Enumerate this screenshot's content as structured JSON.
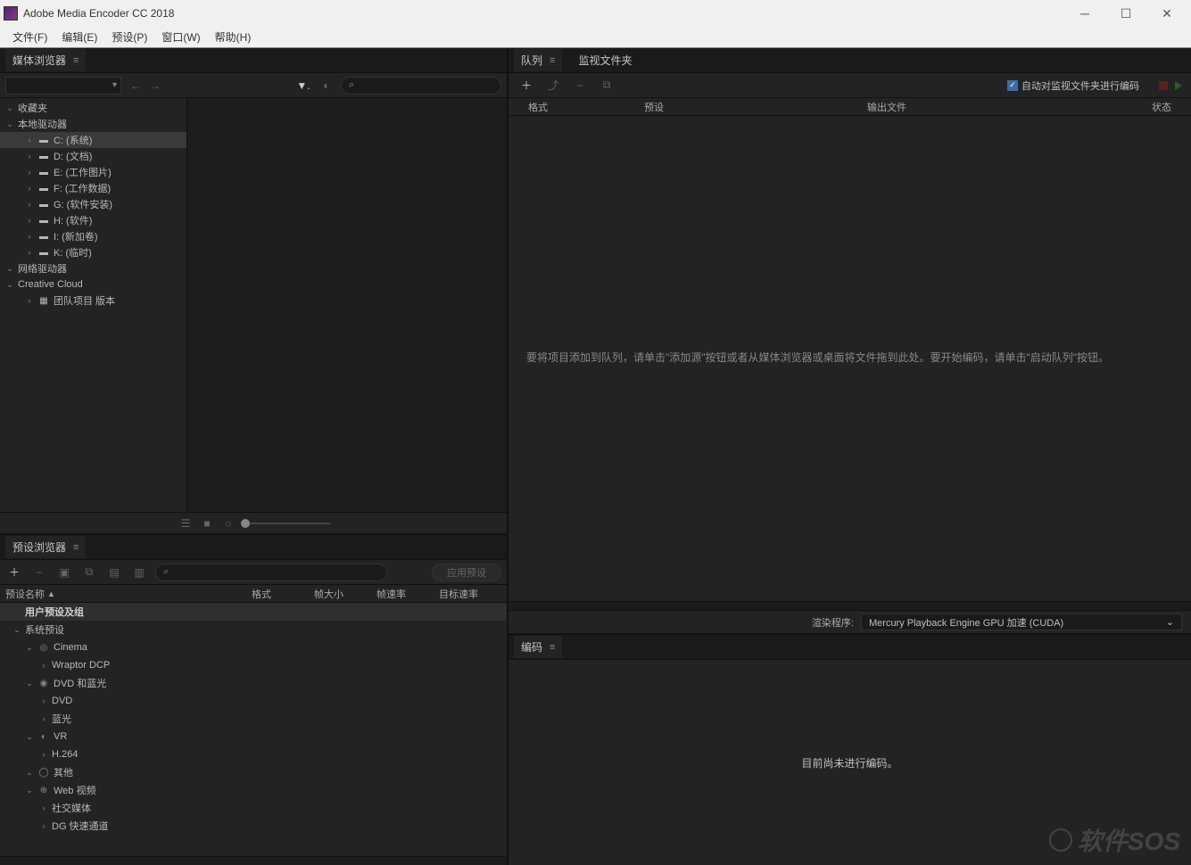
{
  "titlebar": {
    "title": "Adobe Media Encoder CC 2018"
  },
  "menubar": {
    "file": "文件(F)",
    "edit": "编辑(E)",
    "preset": "预设(P)",
    "window": "窗口(W)",
    "help": "帮助(H)"
  },
  "mediaBrowser": {
    "tab": "媒体浏览器",
    "tree": {
      "favorites": "收藏夹",
      "localDrives": "本地驱动器",
      "drives": [
        "C: (系统)",
        "D: (文档)",
        "E: (工作图片)",
        "F: (工作数据)",
        "G: (软件安装)",
        "H: (软件)",
        "I: (新加卷)",
        "K: (临时)"
      ],
      "networkDrives": "网络驱动器",
      "creativeCloud": "Creative Cloud",
      "teamProject": "团队项目 版本"
    }
  },
  "presetBrowser": {
    "tab": "预设浏览器",
    "applyBtn": "应用预设",
    "cols": {
      "name": "预设名称",
      "format": "格式",
      "frameSize": "帧大小",
      "frameRate": "帧速率",
      "target": "目标速率"
    },
    "userHeader": "用户预设及组",
    "systemHeader": "系统预设",
    "groups": [
      {
        "label": "Cinema",
        "children": [
          "Wraptor DCP"
        ]
      },
      {
        "label": "DVD 和蓝光",
        "children": [
          "DVD",
          "蓝光"
        ]
      },
      {
        "label": "VR",
        "children": [
          "H.264"
        ]
      },
      {
        "label": "其他",
        "children": []
      },
      {
        "label": "Web 视频",
        "children": [
          "社交媒体",
          "DG 快速通道"
        ]
      }
    ]
  },
  "queue": {
    "tabQueue": "队列",
    "tabWatch": "监视文件夹",
    "autoEncode": "自动对监视文件夹进行编码",
    "cols": {
      "format": "格式",
      "preset": "预设",
      "output": "输出文件",
      "status": "状态"
    },
    "dropHint": "要将项目添加到队列，请单击\"添加源\"按钮或者从媒体浏览器或桌面将文件拖到此处。要开始编码，请单击\"启动队列\"按钮。",
    "renderLabel": "渲染程序:",
    "renderValue": "Mercury Playback Engine GPU 加速 (CUDA)"
  },
  "encode": {
    "tab": "编码",
    "empty": "目前尚未进行编码。"
  },
  "watermark": "软件SOS"
}
